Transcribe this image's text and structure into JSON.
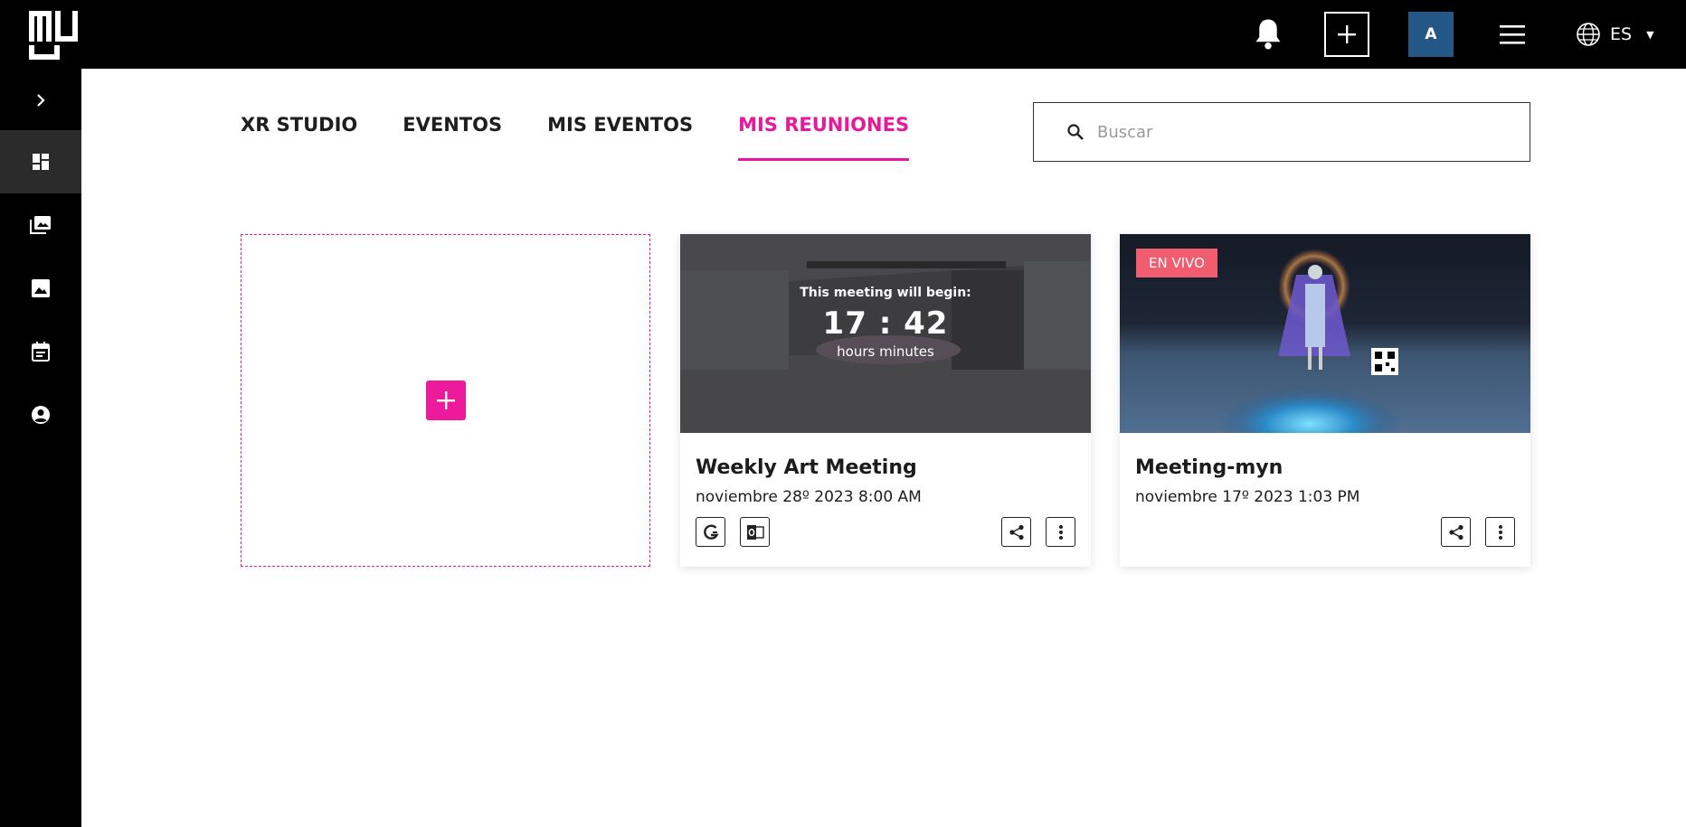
{
  "header": {
    "avatar_initial": "A",
    "language": "ES"
  },
  "tabs": [
    {
      "label": "XR STUDIO",
      "active": false
    },
    {
      "label": "EVENTOS",
      "active": false
    },
    {
      "label": "MIS EVENTOS",
      "active": false
    },
    {
      "label": "MIS REUNIONES",
      "active": true
    }
  ],
  "search": {
    "placeholder": "Buscar",
    "value": ""
  },
  "meetings": [
    {
      "title": "Weekly Art Meeting",
      "date": "noviembre 28º 2023 8:00 AM",
      "countdown_label": "This meeting will begin:",
      "countdown_time": "17 : 42",
      "countdown_units": "hours  minutes"
    },
    {
      "title": "Meeting-myn",
      "date": "noviembre 17º 2023 1:03 PM",
      "badge": "EN VIVO"
    }
  ],
  "colors": {
    "accent": "#e8189a",
    "avatar_bg": "#225786",
    "live_badge": "#f15c6e",
    "chrome": "#000000"
  }
}
